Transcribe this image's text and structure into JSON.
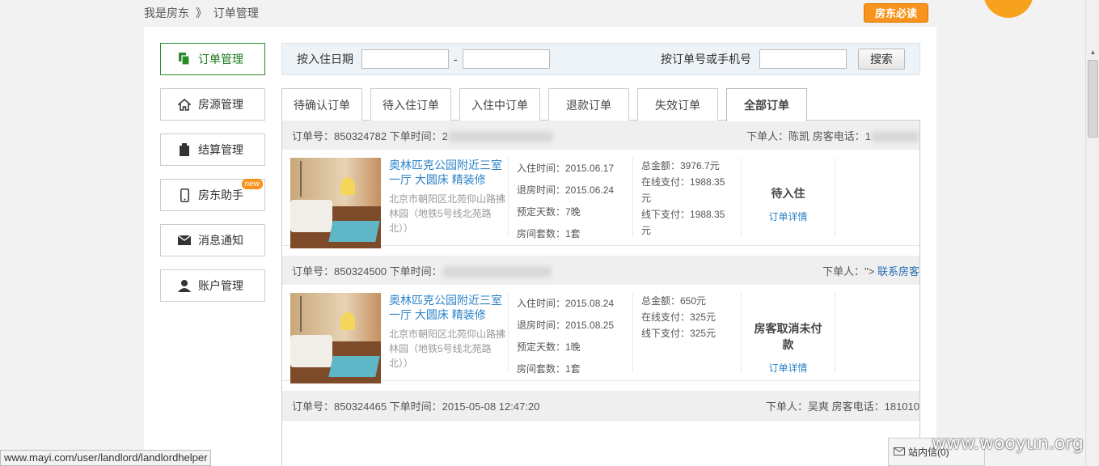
{
  "breadcrumb": {
    "root": "我是房东",
    "sep": "》",
    "current": "订单管理"
  },
  "must_read": "房东必读",
  "sidebar": {
    "items": [
      {
        "label": "订单管理",
        "icon": "copy-icon"
      },
      {
        "label": "房源管理",
        "icon": "house-icon"
      },
      {
        "label": "结算管理",
        "icon": "clipboard-icon"
      },
      {
        "label": "房东助手",
        "icon": "phone-icon",
        "badge": "new"
      },
      {
        "label": "消息通知",
        "icon": "envelope-icon"
      },
      {
        "label": "账户管理",
        "icon": "user-icon"
      }
    ]
  },
  "search": {
    "checkin_label": "按入住日期",
    "date_sep": "-",
    "keyword_label": "按订单号或手机号",
    "button": "搜索"
  },
  "tabs": [
    "待确认订单",
    "待入住订单",
    "入住中订单",
    "退款订单",
    "失效订单",
    "全部订单"
  ],
  "orders": [
    {
      "order_label": "订单号：850324782  下单时间：2",
      "buyer_label": "下单人：陈凯  房客电话：1",
      "buyer_tail": "",
      "contact": "",
      "house_title": "奥林匹克公园附近三室一厅 大圆床 精装修",
      "house_addr": "北京市朝阳区北苑仰山路拂林园（地铁5号线北苑路北））",
      "checkin": "入住时间：2015.06.17",
      "checkout": "退房时间：2015.06.24",
      "nights": "预定天数：7晚",
      "rooms": "房间套数：1套",
      "total": "总金额：3976.7元",
      "online": "在线支付：1988.35元",
      "offline": "线下支付：1988.35元",
      "status": "待入住",
      "detail": "订单详情"
    },
    {
      "order_label": "订单号：850324500  下单时间：",
      "buyer_label": "下单人：\">",
      "contact": "联系房客",
      "house_title": "奥林匹克公园附近三室一厅 大圆床 精装修",
      "house_addr": "北京市朝阳区北苑仰山路拂林园（地铁5号线北苑路北））",
      "checkin": "入住时间：2015.08.24",
      "checkout": "退房时间：2015.08.25",
      "nights": "预定天数：1晚",
      "rooms": "房间套数：1套",
      "total": "总金额：650元",
      "online": "在线支付：325元",
      "offline": "线下支付：325元",
      "status": "房客取消未付款",
      "detail": "订单详情"
    },
    {
      "order_label": "订单号：850324465  下单时间：2015-05-08 12:47:20",
      "buyer_label": "下单人：吴爽  房客电话：181010"
    }
  ],
  "status_bar": "www.mayi.com/user/landlord/landlordhelper",
  "inbox": "站内信(0)",
  "watermark": "www.wooyun.org"
}
